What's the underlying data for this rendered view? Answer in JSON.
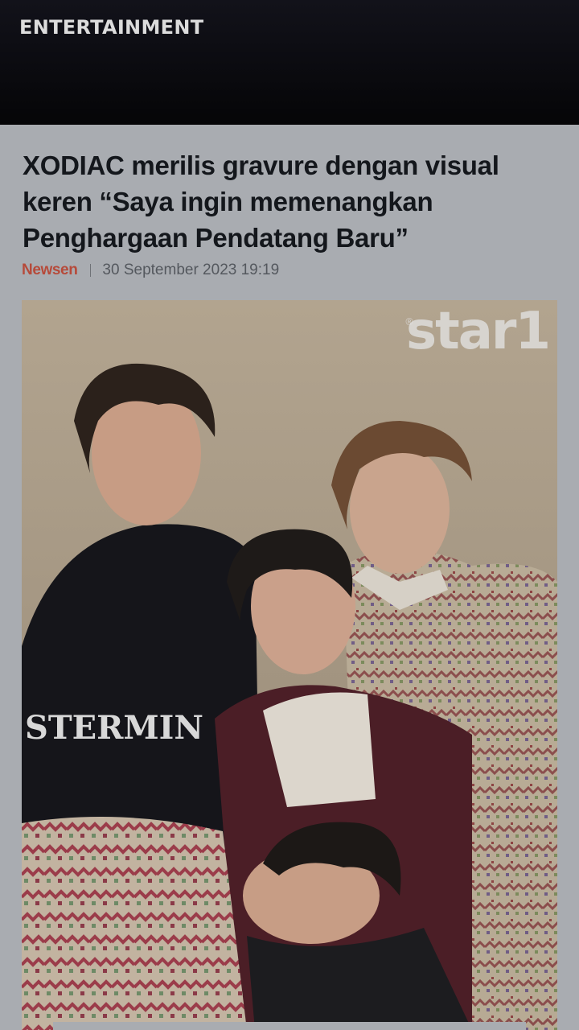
{
  "header": {
    "section": "ENTERTAINMENT"
  },
  "article": {
    "title": "XODIAC merilis gravure dengan visual keren “Saya ingin memenangkan Penghargaan Pendatang Baru”",
    "source": "Newsen",
    "date": "30 September 2023 19:19"
  },
  "photo": {
    "watermark": "star1",
    "watermark_mark": "®",
    "shirt_text": "STERMIN"
  },
  "colors": {
    "topbar": "#0b0b10",
    "page_background": "#a9acb1",
    "headline": "#14171c",
    "source_brand": "#b64a3a"
  }
}
